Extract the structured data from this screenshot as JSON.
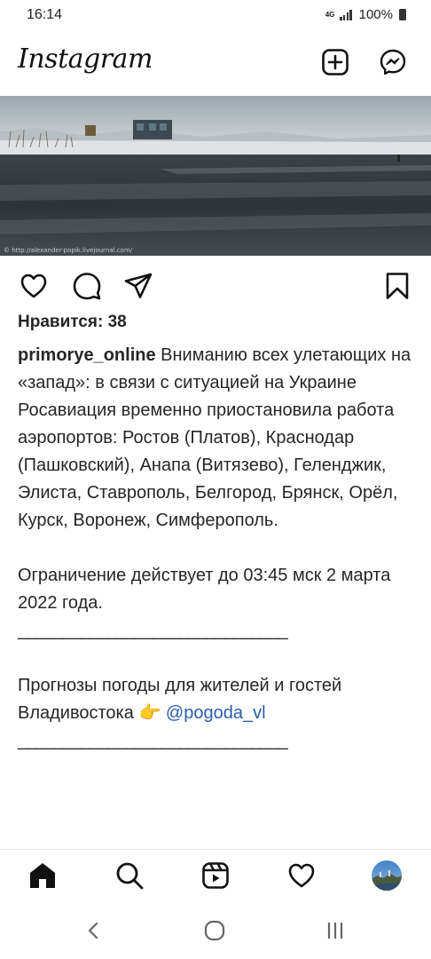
{
  "status_bar": {
    "time": "16:14",
    "network": "4G",
    "battery": "100%"
  },
  "header": {
    "app_title": "Instagram",
    "icons": [
      "new-post-icon",
      "messenger-icon"
    ]
  },
  "post": {
    "image_watermark": "© http://alexander-popik.livejournal.com/",
    "likes_text": "Нравится: 38",
    "username": "primorye_online",
    "caption_first": "Вниманию всех улетающих на «запад»: в связи с ситуацией на Украине Росавиация временно приостановила работа аэропортов: Ростов (Платов), Краснодар (Пашковский), Анапа (Витязево), Геленджик, Элиста, Ставрополь, Белгород, Брянск, Орёл, Курск, Воронеж, Симферополь.",
    "restriction": "Ограничение действует до 03:45 мск 2 марта 2022 года.",
    "divider1": "______________________________",
    "forecast_text": "Прогнозы погоды для жителей и гостей Владивостока",
    "forecast_emoji": "👉",
    "mention": "@pogoda_vl",
    "divider2": "______________________________"
  },
  "bottom_nav": [
    "home-icon",
    "search-icon",
    "reels-icon",
    "activity-icon",
    "profile-avatar"
  ],
  "system_nav": [
    "back-icon",
    "home-circle-icon",
    "recents-icon"
  ],
  "colors": {
    "text": "#262626",
    "mention": "#2a5db0",
    "background": "#ffffff"
  }
}
